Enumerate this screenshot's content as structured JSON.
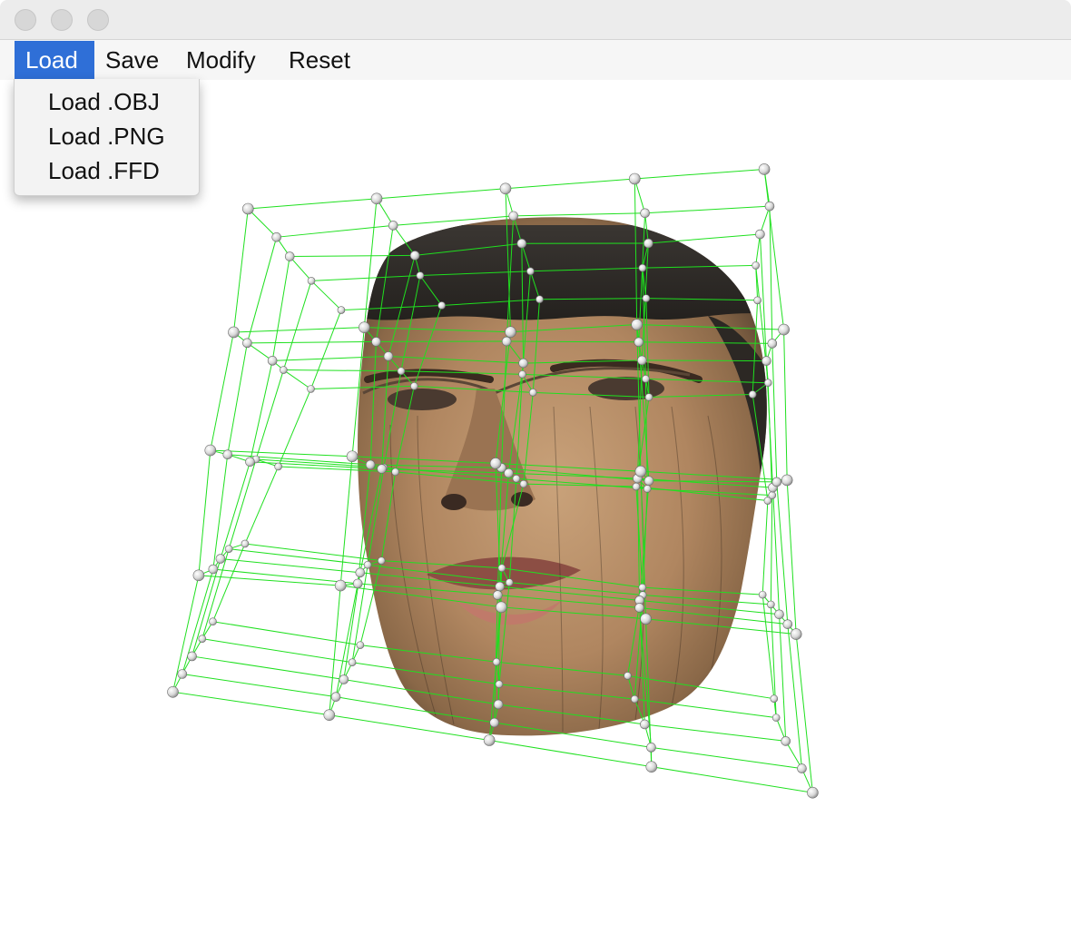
{
  "window": {
    "title": "",
    "controls": [
      "close",
      "minimize",
      "zoom"
    ]
  },
  "menubar": {
    "items": [
      {
        "label": "Load",
        "active": true
      },
      {
        "label": "Save",
        "active": false
      },
      {
        "label": "Modify",
        "active": false
      },
      {
        "label": "Reset",
        "active": false
      }
    ]
  },
  "dropdown": {
    "items": [
      "Load .OBJ",
      "Load .PNG",
      "Load .FFD"
    ]
  },
  "scene": {
    "model": "textured face mesh",
    "lattice_color": "#1fe01f",
    "control_point_color": "#f2f2f2"
  }
}
